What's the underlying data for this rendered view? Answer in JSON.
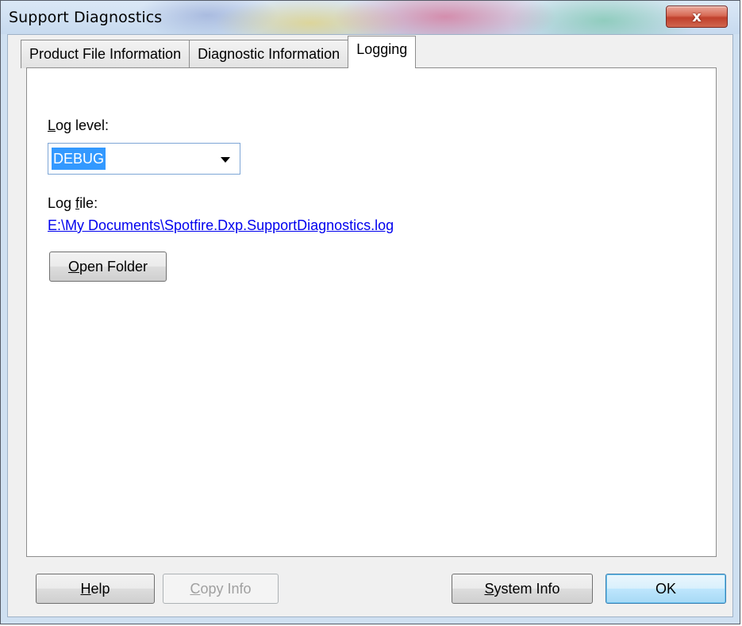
{
  "window": {
    "title": "Support Diagnostics",
    "close_symbol": "x"
  },
  "tabs": [
    {
      "label": "Product File Information",
      "active": false
    },
    {
      "label": "Diagnostic Information",
      "active": false
    },
    {
      "label": "Logging",
      "active": true
    }
  ],
  "logging": {
    "log_level_label_mnemonic": "L",
    "log_level_label_rest": "og level:",
    "log_level_value": "DEBUG",
    "log_file_label_prefix": "Log ",
    "log_file_label_mnemonic": "f",
    "log_file_label_rest": "ile:",
    "log_file_path": "E:\\My Documents\\Spotfire.Dxp.SupportDiagnostics.log",
    "open_folder_mnemonic": "O",
    "open_folder_rest": "pen Folder"
  },
  "footer": {
    "help_mnemonic": "H",
    "help_rest": "elp",
    "copy_info_mnemonic": "C",
    "copy_info_rest": "opy Info",
    "system_info_mnemonic": "S",
    "system_info_rest": "ystem Info",
    "ok_label": "OK"
  },
  "icons": {
    "close": "close-icon",
    "dropdown": "chevron-down-icon"
  }
}
